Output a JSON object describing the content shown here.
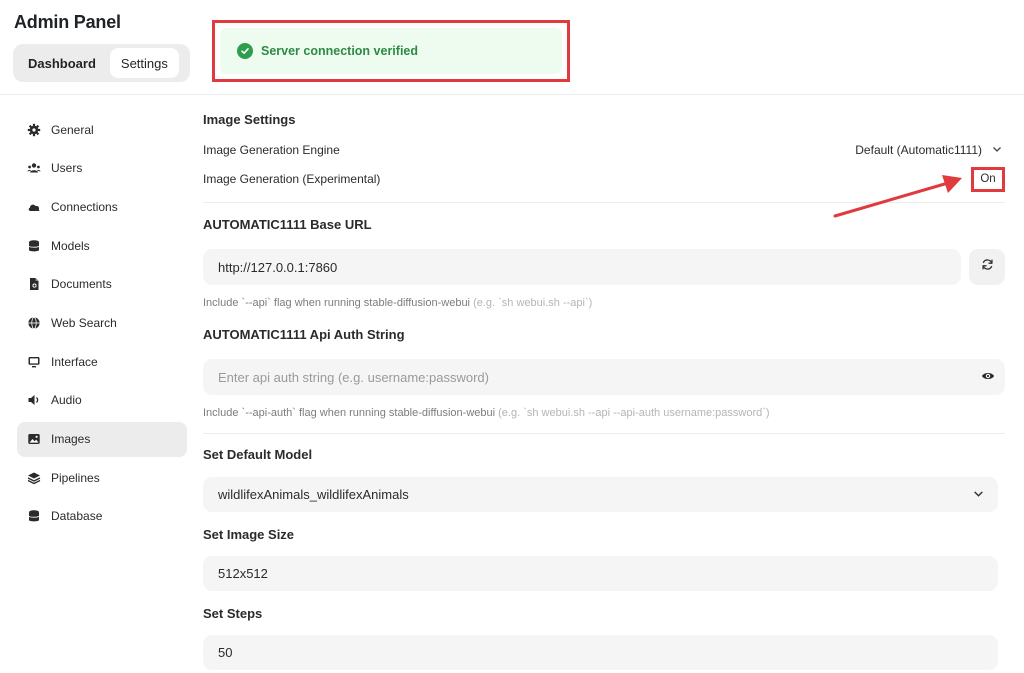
{
  "app": {
    "title": "Admin Panel"
  },
  "tabs": [
    {
      "label": "Dashboard",
      "active": false
    },
    {
      "label": "Settings",
      "active": true
    }
  ],
  "toast": {
    "message": "Server connection verified",
    "icon": "check-circle-icon",
    "color": "#2e9e4e"
  },
  "sidebar": {
    "items": [
      {
        "label": "General",
        "icon": "gear-icon"
      },
      {
        "label": "Users",
        "icon": "users-icon"
      },
      {
        "label": "Connections",
        "icon": "cloud-icon"
      },
      {
        "label": "Models",
        "icon": "database-icon"
      },
      {
        "label": "Documents",
        "icon": "document-icon"
      },
      {
        "label": "Web Search",
        "icon": "globe-icon"
      },
      {
        "label": "Interface",
        "icon": "monitor-icon"
      },
      {
        "label": "Audio",
        "icon": "speaker-icon"
      },
      {
        "label": "Images",
        "icon": "image-icon",
        "active": true
      },
      {
        "label": "Pipelines",
        "icon": "layers-icon"
      },
      {
        "label": "Database",
        "icon": "database-icon"
      }
    ]
  },
  "image_settings": {
    "title": "Image Settings",
    "engine_label": "Image Generation Engine",
    "engine_value": "Default (Automatic1111)",
    "generation_label": "Image Generation (Experimental)",
    "generation_value": "On"
  },
  "base_url": {
    "label": "AUTOMATIC1111 Base URL",
    "value": "http://127.0.0.1:7860",
    "hint": "Include `--api` flag when running stable-diffusion-webui",
    "hint_example": "(e.g. `sh webui.sh --api`)"
  },
  "auth": {
    "label": "AUTOMATIC1111 Api Auth String",
    "placeholder": "Enter api auth string (e.g. username:password)",
    "hint": "Include `--api-auth` flag when running stable-diffusion-webui",
    "hint_example": "(e.g. `sh webui.sh --api --api-auth username:password`)"
  },
  "default_model": {
    "label": "Set Default Model",
    "value": "wildlifexAnimals_wildlifexAnimals"
  },
  "image_size": {
    "label": "Set Image Size",
    "value": "512x512"
  },
  "steps": {
    "label": "Set Steps",
    "value": "50"
  },
  "colors": {
    "highlight": "#e0393e",
    "accent_green": "#2e9e4e"
  }
}
